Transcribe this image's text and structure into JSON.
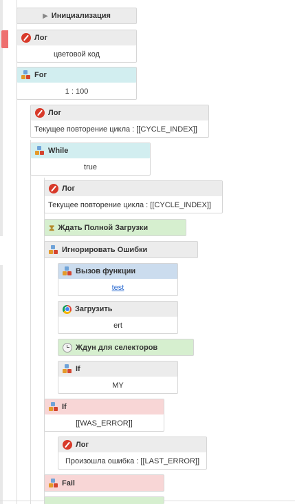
{
  "colors": {
    "gray_header": "#ececec",
    "cyan_header": "#d2eef0",
    "green_header": "#d6efcf",
    "blue_header": "#cbdcee",
    "pink_header": "#f8d6d6",
    "active_marker": "#ee6f6f",
    "link": "#2a6ad0"
  },
  "blocks": {
    "init": {
      "title": "Инициализация",
      "icon": "play-icon"
    },
    "log1": {
      "title": "Лог",
      "body": "цветовой код",
      "icon": "log-icon"
    },
    "for1": {
      "title": "For",
      "body": "1 : 100",
      "icon": "bricks-icon"
    },
    "log2": {
      "title": "Лог",
      "body": "Текущее повторение цикла : [[CYCLE_INDEX]]",
      "icon": "log-icon"
    },
    "while1": {
      "title": "While",
      "body": "true",
      "icon": "bricks-icon"
    },
    "log3": {
      "title": "Лог",
      "body": "Текущее повторение цикла : [[CYCLE_INDEX]]",
      "icon": "log-icon"
    },
    "wait_load": {
      "title": "Ждать Полной Загрузки",
      "icon": "hourglass-icon"
    },
    "ignore_err": {
      "title": "Игнорировать Ошибки",
      "icon": "bricks-icon"
    },
    "call_func": {
      "title": "Вызов функции",
      "body": "test",
      "icon": "bricks-icon"
    },
    "load": {
      "title": "Загрузить",
      "body": "ert",
      "icon": "chrome-icon"
    },
    "wait_sel": {
      "title": "Ждун для селекторов",
      "icon": "clock-icon"
    },
    "if_my": {
      "title": "If",
      "body": "MY",
      "icon": "bricks-icon"
    },
    "if_err": {
      "title": "If",
      "body": "[[WAS_ERROR]]",
      "icon": "bricks-icon"
    },
    "log4": {
      "title": "Лог",
      "body": "Произошла ошибка : [[LAST_ERROR]]",
      "icon": "log-icon"
    },
    "fail": {
      "title": "Fail",
      "icon": "bricks-icon"
    }
  }
}
